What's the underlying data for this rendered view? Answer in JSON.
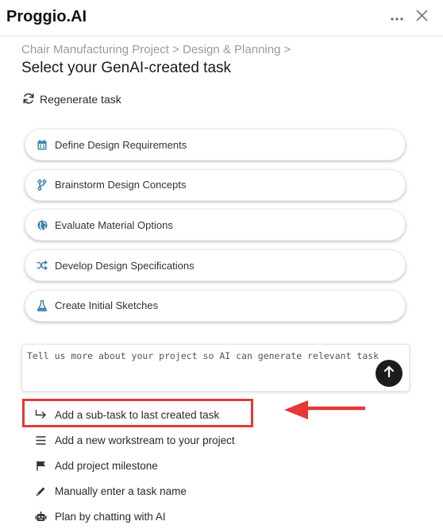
{
  "header": {
    "app_title": "Proggio.AI",
    "more_icon": "ellipsis-icon",
    "close_icon": "close-icon"
  },
  "breadcrumb": "Chair Manufacturing Project > Design & Planning >",
  "page_title": "Select your GenAI-created task",
  "regenerate": {
    "label": "Regenerate task",
    "icon": "refresh-icon"
  },
  "tasks": [
    {
      "label": "Define Design Requirements",
      "icon": "calendar-icon"
    },
    {
      "label": "Brainstorm Design Concepts",
      "icon": "branch-icon"
    },
    {
      "label": "Evaluate Material Options",
      "icon": "globe-icon"
    },
    {
      "label": "Develop Design Specifications",
      "icon": "shuffle-icon"
    },
    {
      "label": "Create Initial Sketches",
      "icon": "flask-icon"
    }
  ],
  "prompt": {
    "placeholder": "Tell us more about your project so AI can generate relevant task",
    "send_icon": "arrow-up-icon"
  },
  "actions": [
    {
      "label": "Add a sub-task to last created task",
      "icon": "subtask-arrow-icon"
    },
    {
      "label": "Add a new workstream to your project",
      "icon": "list-icon"
    },
    {
      "label": "Add project milestone",
      "icon": "flag-icon"
    },
    {
      "label": "Manually enter a task name",
      "icon": "pencil-icon"
    },
    {
      "label": "Plan by chatting with AI",
      "icon": "robot-icon"
    }
  ],
  "colors": {
    "task_icon": "#3b82a8",
    "annotation_red": "#e53935",
    "send_button": "#1c1c1c"
  }
}
